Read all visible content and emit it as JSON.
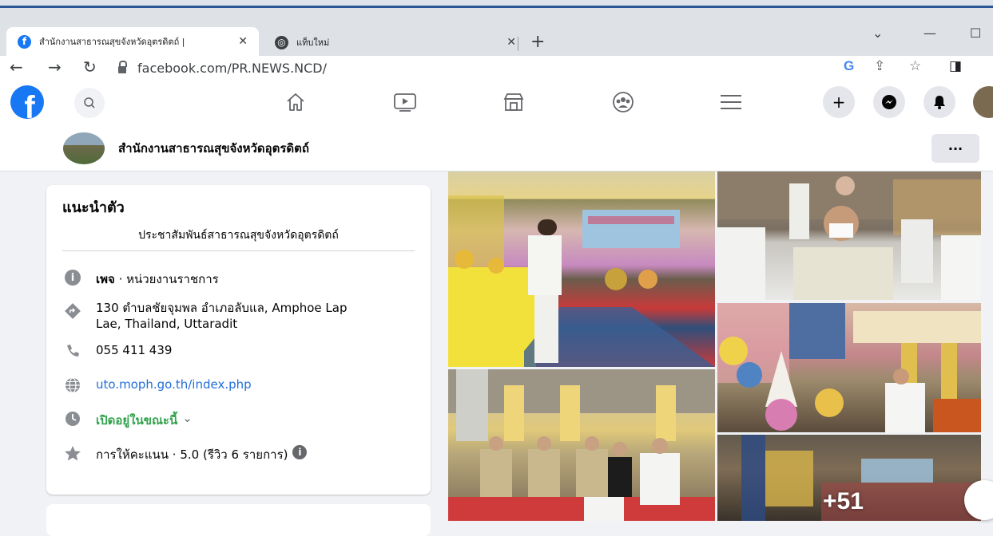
{
  "browser": {
    "tabs": [
      {
        "title": "สำนักงานสาธารณสุขจังหวัดอุตรดิตถ์ |",
        "close": "✕"
      },
      {
        "title": "แท็บใหม่",
        "close": "✕"
      }
    ],
    "new_tab": "+",
    "url": "facebook.com/PR.NEWS.NCD/"
  },
  "facebook": {
    "logo": "f",
    "nav_icons": [
      "home-icon",
      "watch-icon",
      "marketplace-icon",
      "groups-icon",
      "menu-icon"
    ],
    "actions": [
      "create-icon",
      "messenger-icon",
      "notifications-icon"
    ]
  },
  "page": {
    "name": "สำนักงานสาธารณสุขจังหวัดอุตรดิตถ์",
    "more": "···"
  },
  "intro": {
    "heading": "แนะนำตัว",
    "bio": "ประชาสัมพันธ์สาธารณสุขจังหวัดอุตรดิตถ์",
    "category_bold": "เพจ",
    "category_rest": " · หน่วยงานราชการ",
    "address_line1": "130 ตำบลชัยจุมพล อำเภอลับแล, Amphoe Lap",
    "address_line2": "Lae, Thailand, Uttaradit",
    "phone": "055 411 439",
    "website": "uto.moph.go.th/index.php",
    "hours": "เปิดอยู่ในขณะนี้",
    "hours_caret": "⌄",
    "rating": "การให้คะแนน · 5.0 (รีวิว 6 รายการ)",
    "info_glyph": "i"
  },
  "photos": {
    "more_count": "+51"
  }
}
